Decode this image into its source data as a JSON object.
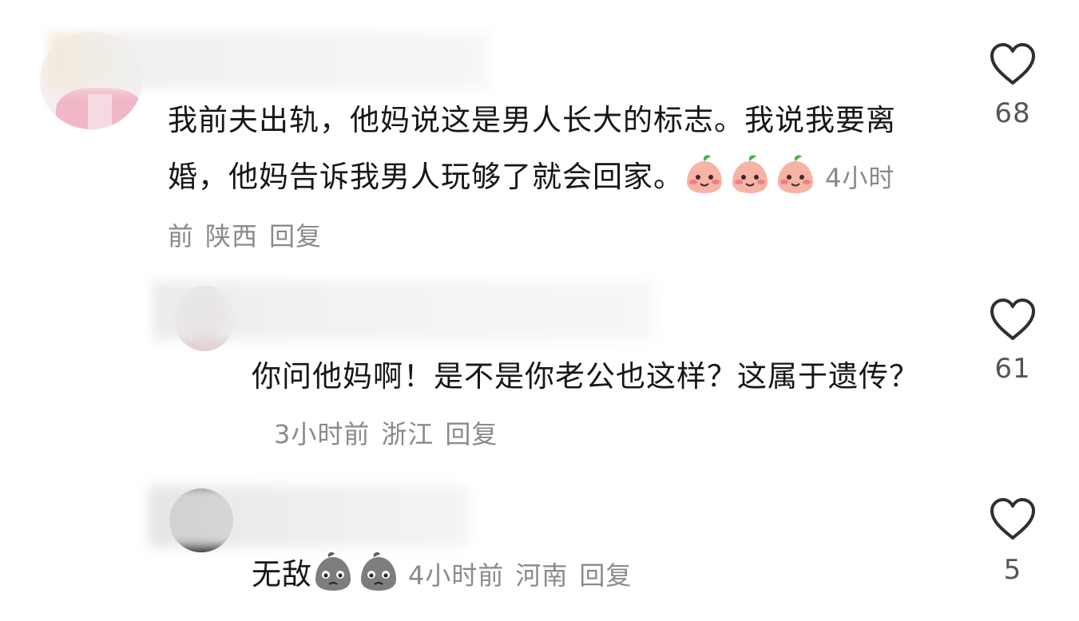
{
  "comments": [
    {
      "text": "我前夫出轨，他妈说这是男人长大的标志。我说我要离婚，他妈告诉我男人玩够了就会回家。",
      "emoji_icon": "blushing-peach-emoji",
      "time": "4小时前",
      "location": "陕西",
      "reply_label": "回复",
      "likes": "68",
      "avatar_color": "#f4c6cf"
    },
    {
      "text": "你问他妈啊！是不是你老公也这样？这属于遗传？",
      "time": "3小时前",
      "location": "浙江",
      "reply_label": "回复",
      "likes": "61",
      "avatar_color": "#d9b8b9"
    },
    {
      "text": "无敌",
      "emoji_icon": "gray-sad-blob-emoji",
      "time": "4小时前",
      "location": "河南",
      "reply_label": "回复",
      "likes": "5",
      "avatar_color": "#2a2a2a"
    }
  ],
  "icons": {
    "like": "heart-outline-icon"
  },
  "colors": {
    "text": "#161616",
    "meta": "#8a8a8a",
    "like_count": "#555555"
  }
}
